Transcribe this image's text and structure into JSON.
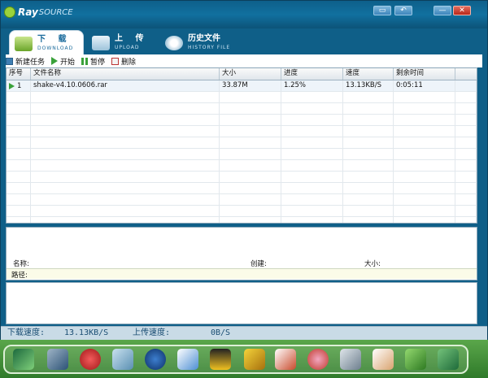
{
  "window": {
    "logo_brand": "Ray",
    "logo_sub": "SOURCE",
    "buttons": {
      "restore": "▭",
      "back": "↶",
      "minimize": "—",
      "close": "✕"
    }
  },
  "tabs": [
    {
      "cn": "下 载",
      "en": "DOWNLOAD"
    },
    {
      "cn": "上 传",
      "en": "UPLOAD"
    },
    {
      "cn": "历史文件",
      "en": "HISTORY FILE"
    }
  ],
  "toolbar": {
    "new_task": "新建任务",
    "start": "开始",
    "pause": "暂停",
    "delete": "删除"
  },
  "table": {
    "headers": [
      "序号",
      "文件名称",
      "大小",
      "进度",
      "速度",
      "剩余时间"
    ],
    "rows": [
      [
        "1",
        "shake-v4.10.0606.rar",
        "33.87M",
        "1.25%",
        "13.13KB/S",
        "0:05:11"
      ]
    ]
  },
  "detail": {
    "name_label": "名称:",
    "create_label": "创建:",
    "size_label": "大小:",
    "path_label": "路径:"
  },
  "status": {
    "download_label": "下载速度:",
    "download_value": "13.13KB/S",
    "upload_label": "上传速度:",
    "upload_value": "0B/S"
  },
  "colors": {
    "title_bar": "#0e5f8a",
    "accent": "#1a6b9c"
  }
}
